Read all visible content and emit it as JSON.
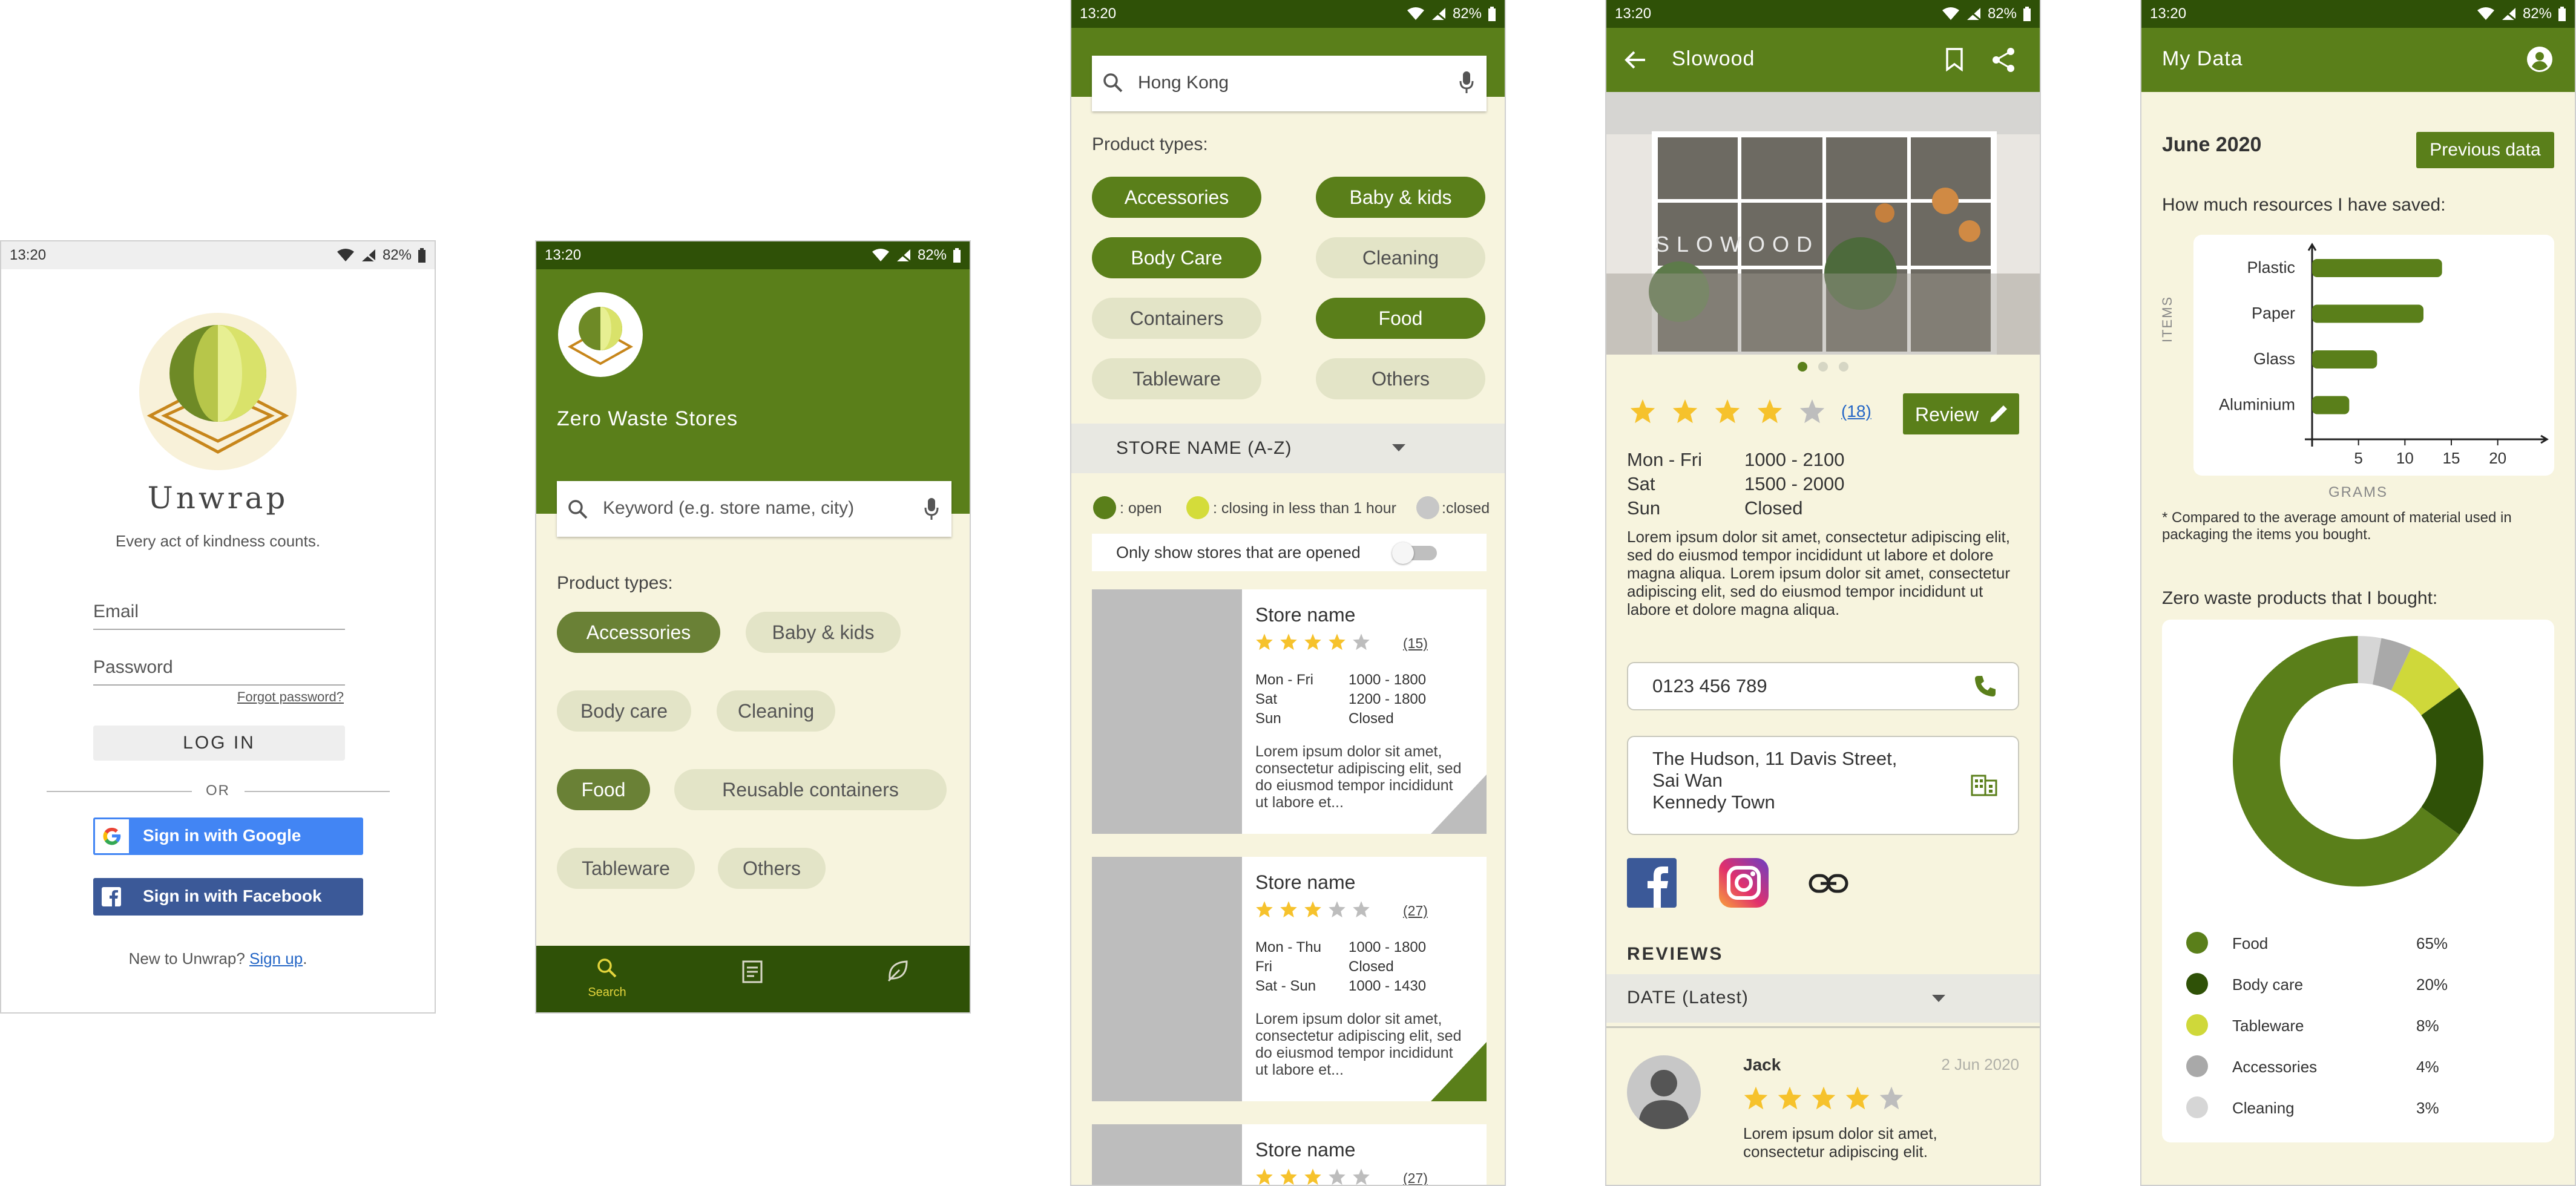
{
  "status": {
    "time": "13:20",
    "battery": "82%"
  },
  "colors": {
    "green": "#5a7f1a",
    "dark_green": "#2f5107",
    "cream": "#f7f4de",
    "chip_off": "#e3e4c7",
    "star": "#f6c22c",
    "link": "#2466c6"
  },
  "login": {
    "app_name": "Unwrap",
    "tagline": "Every act of kindness counts.",
    "email_label": "Email",
    "password_label": "Password",
    "forgot": "Forgot password?",
    "login_button": "LOG IN",
    "or": "OR",
    "google": "Sign in with Google",
    "facebook": "Sign in with Facebook",
    "new_prefix": "New to Unwrap? ",
    "signup": "Sign up",
    "new_suffix": "."
  },
  "home": {
    "title": "Zero Waste Stores",
    "search_placeholder": "Keyword (e.g. store name, city)",
    "product_types_label": "Product types:",
    "chips": [
      {
        "label": "Accessories",
        "selected": true
      },
      {
        "label": "Baby & kids",
        "selected": false
      },
      {
        "label": "Body care",
        "selected": false
      },
      {
        "label": "Cleaning",
        "selected": false
      },
      {
        "label": "Food",
        "selected": true
      },
      {
        "label": "Reusable containers",
        "selected": false
      },
      {
        "label": "Tableware",
        "selected": false
      },
      {
        "label": "Others",
        "selected": false
      }
    ],
    "nav": [
      {
        "icon": "search-icon",
        "label": "Search"
      },
      {
        "icon": "list-icon",
        "label": ""
      },
      {
        "icon": "leaf-icon",
        "label": ""
      }
    ]
  },
  "results": {
    "search_value": "Hong Kong",
    "product_types_label": "Product types:",
    "chips": [
      {
        "label": "Accessories",
        "selected": true
      },
      {
        "label": "Baby & kids",
        "selected": true
      },
      {
        "label": "Body Care",
        "selected": true
      },
      {
        "label": "Cleaning",
        "selected": false
      },
      {
        "label": "Containers",
        "selected": false
      },
      {
        "label": "Food",
        "selected": true
      },
      {
        "label": "Tableware",
        "selected": false
      },
      {
        "label": "Others",
        "selected": false
      }
    ],
    "sort_label": "STORE NAME (A-Z)",
    "legend_open": ": open",
    "legend_closing": ": closing in less than 1 hour",
    "legend_closed": ":closed",
    "only_open_label": "Only show stores that are opened",
    "cards": [
      {
        "name": "Store name",
        "rating": 4,
        "count": "(15)",
        "hours": [
          [
            "Mon - Fri",
            "1000 - 1800"
          ],
          [
            "Sat",
            "1200 - 1800"
          ],
          [
            "Sun",
            "Closed"
          ]
        ],
        "desc": "Lorem ipsum dolor sit amet, consectetur adipiscing elit, sed do eiusmod tempor incididunt ut labore et...",
        "status": "closed"
      },
      {
        "name": "Store name",
        "rating": 3,
        "count": "(27)",
        "hours": [
          [
            "Mon - Thu",
            "1000 - 1800"
          ],
          [
            "Fri",
            "Closed"
          ],
          [
            "Sat - Sun",
            "1000 - 1430"
          ]
        ],
        "desc": "Lorem ipsum dolor sit amet, consectetur adipiscing elit, sed do eiusmod tempor incididunt ut labore et...",
        "status": "open"
      },
      {
        "name": "Store name",
        "rating": 3,
        "count": "(27)"
      }
    ]
  },
  "store": {
    "title": "Slowood",
    "sign_text": "SLOWOOD",
    "rating": 4,
    "review_count": "(18)",
    "review_button": "Review",
    "hours": [
      [
        "Mon - Fri",
        "1000 - 2100"
      ],
      [
        "Sat",
        "1500 - 2000"
      ],
      [
        "Sun",
        "Closed"
      ]
    ],
    "desc": "Lorem ipsum dolor sit amet, consectetur adipiscing elit, sed do eiusmod tempor incididunt ut labore et dolore magna aliqua. Lorem ipsum dolor sit amet, consectetur adipiscing elit, sed do eiusmod tempor incididunt ut labore et dolore magna aliqua.",
    "phone": "0123 456 789",
    "address_lines": [
      "The Hudson, 11 Davis Street,",
      "Sai Wan",
      "Kennedy Town"
    ],
    "reviews_heading": "REVIEWS",
    "reviews_sort": "DATE (Latest)",
    "review": {
      "name": "Jack",
      "date": "2 Jun 2020",
      "rating": 4,
      "text": "Lorem ipsum dolor sit amet, consectetur adipiscing elit."
    }
  },
  "mydata": {
    "title": "My Data",
    "month": "June 2020",
    "previous_button": "Previous data",
    "question": "How much resources I have saved:",
    "bar_chart": {
      "categories": [
        "Plastic",
        "Paper",
        "Glass",
        "Aluminium"
      ],
      "values": [
        14,
        12,
        7,
        4
      ],
      "x_ticks": [
        "5",
        "10",
        "15",
        "20"
      ],
      "xlabel": "GRAMS",
      "ylabel": "ITEMS",
      "xlim": [
        0,
        24
      ]
    },
    "footnote": "* Compared to the average amount of material used in packaging the items you bought.",
    "products_heading": "Zero waste products that I bought:",
    "donut": [
      {
        "name": "Food",
        "pct": "65%",
        "value": 65,
        "color": "#5a7f1a"
      },
      {
        "name": "Body care",
        "pct": "20%",
        "value": 20,
        "color": "#2f5107"
      },
      {
        "name": "Tableware",
        "pct": "8%",
        "value": 8,
        "color": "#cfd83a"
      },
      {
        "name": "Accessories",
        "pct": "4%",
        "value": 4,
        "color": "#a9a9a9"
      },
      {
        "name": "Cleaning",
        "pct": "3%",
        "value": 3,
        "color": "#d6d6d6"
      }
    ]
  }
}
